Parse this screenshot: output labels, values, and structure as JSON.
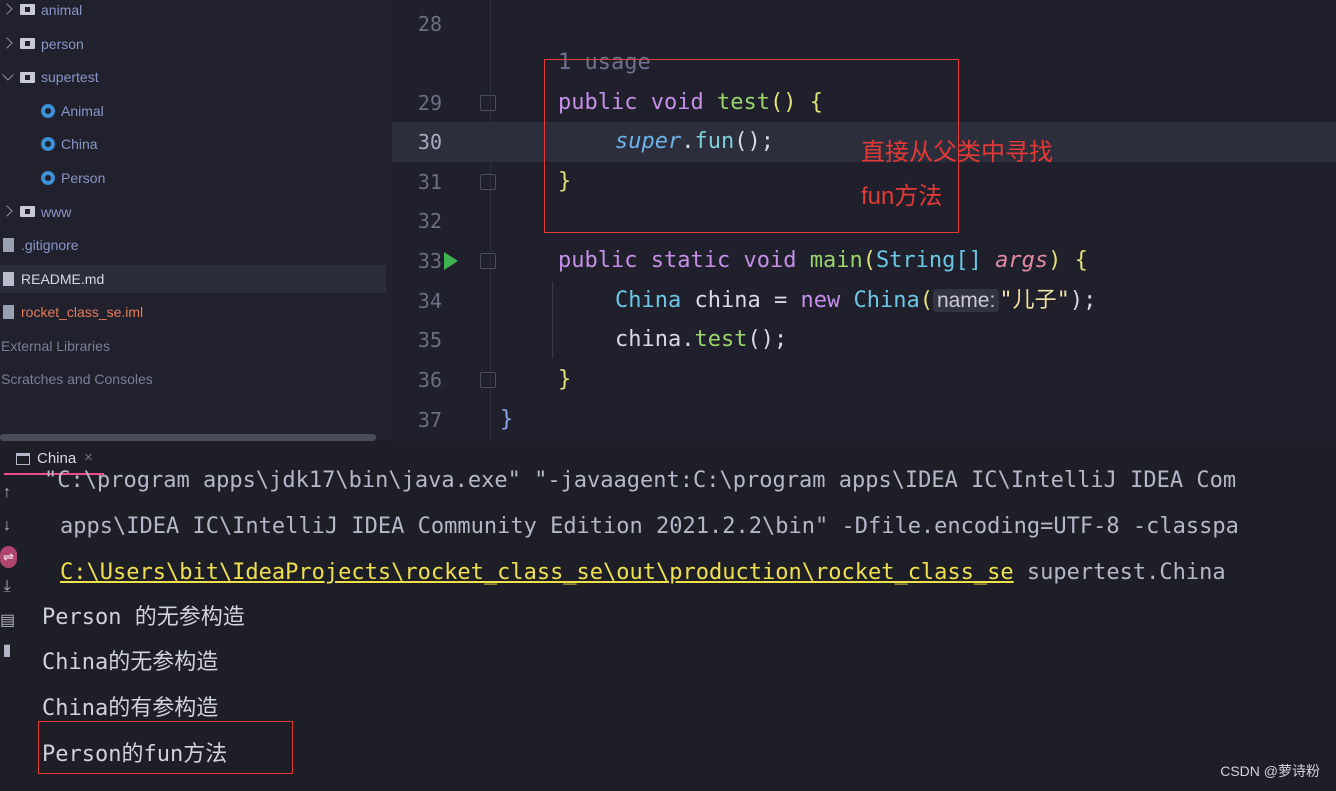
{
  "project_tree": {
    "items": [
      {
        "label": "animal",
        "kind": "folder",
        "expanded": false
      },
      {
        "label": "person",
        "kind": "folder",
        "expanded": false
      },
      {
        "label": "supertest",
        "kind": "folder",
        "expanded": true
      },
      {
        "label": "Animal",
        "kind": "class"
      },
      {
        "label": "China",
        "kind": "class"
      },
      {
        "label": "Person",
        "kind": "class"
      },
      {
        "label": "www",
        "kind": "folder",
        "expanded": false
      },
      {
        "label": ".gitignore",
        "kind": "file"
      },
      {
        "label": "README.md",
        "kind": "file",
        "selected": true
      },
      {
        "label": "rocket_class_se.iml",
        "kind": "file"
      },
      {
        "label": "External Libraries",
        "kind": "group"
      },
      {
        "label": "Scratches and Consoles",
        "kind": "group"
      }
    ]
  },
  "editor": {
    "line_numbers": [
      "28",
      "29",
      "30",
      "31",
      "32",
      "33",
      "34",
      "35",
      "36",
      "37"
    ],
    "current_line": "30",
    "usage_hint": "1 usage",
    "code": {
      "l29": {
        "kw1": "public",
        "kw2": "void",
        "name": "test",
        "parens": "()",
        "brace": "{"
      },
      "l30": {
        "super": "super",
        "dot": ".",
        "call": "fun",
        "rest": "();"
      },
      "l31": {
        "brace": "}"
      },
      "l33": {
        "kw1": "public",
        "kw2": "static",
        "kw3": "void",
        "name": "main",
        "open": "(",
        "type": "String[]",
        "param": "args",
        "close": ")",
        "brace": "{"
      },
      "l34": {
        "type": "China",
        "var": "china",
        "eq": "=",
        "kw": "new",
        "ctor": "China",
        "open": "(",
        "hint": "name:",
        "arg": "\"儿子\"",
        "close": ");"
      },
      "l35": {
        "obj": "china",
        "dot": ".",
        "call": "test",
        "rest": "();"
      },
      "l36": {
        "brace": "}"
      },
      "l37": {
        "brace": "}"
      }
    }
  },
  "annotations": {
    "line1": "直接从父类中寻找",
    "line2": "fun方法"
  },
  "run_panel": {
    "tab_label": "China",
    "output": {
      "cmd1": "\"C:\\program apps\\jdk17\\bin\\java.exe\" \"-javaagent:C:\\program apps\\IDEA IC\\IntelliJ IDEA Com",
      "cmd2": "apps\\IDEA IC\\IntelliJ IDEA Community Edition 2021.2.2\\bin\" -Dfile.encoding=UTF-8 -classpa",
      "cmd3_link": "C:\\Users\\bit\\IdeaProjects\\rocket_class_se\\out\\production\\rocket_class_se",
      "cmd3_rest": " supertest.China",
      "lines": [
        "Person 的无参构造",
        "China的无参构造",
        "China的有参构造",
        "Person的fun方法"
      ]
    }
  },
  "watermark": "CSDN @萝诗粉",
  "colors": {
    "keyword": "#c58fe8",
    "function": "#9ad46a",
    "type": "#6cc7e6",
    "annotation": "#e53935",
    "link": "#f0e04b"
  }
}
